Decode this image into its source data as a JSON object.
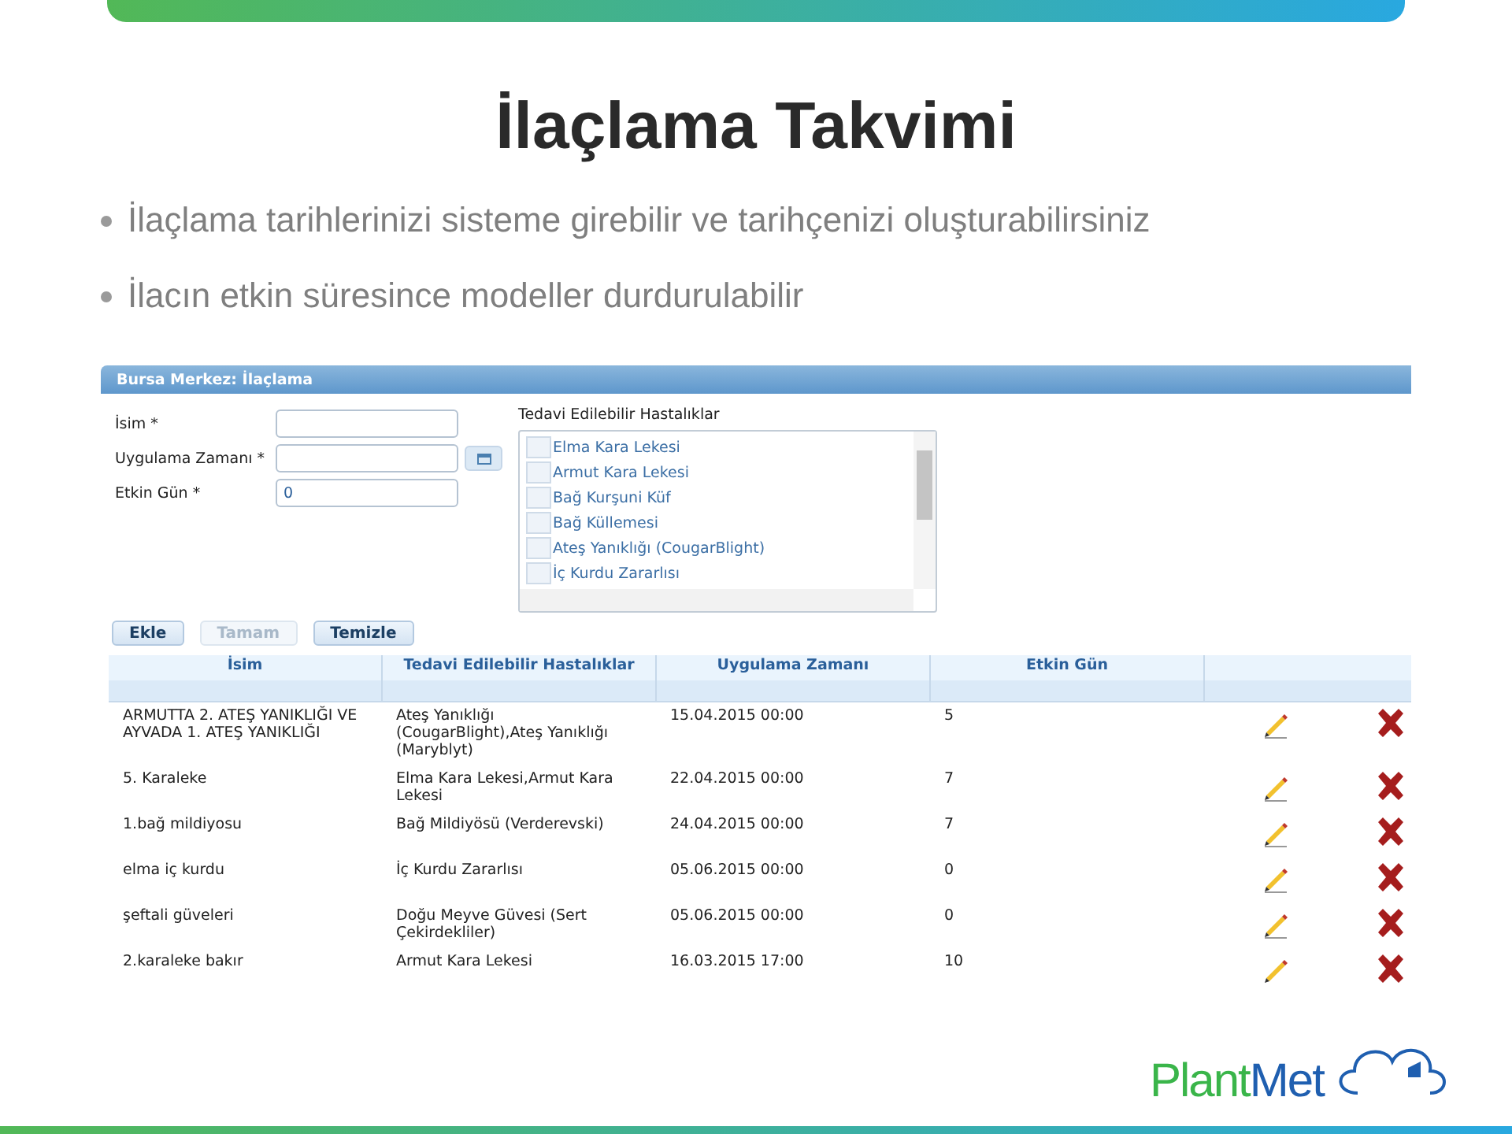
{
  "title": "İlaçlama Takvimi",
  "bullets": [
    "İlaçlama tarihlerinizi sisteme girebilir ve tarihçenizi oluşturabilirsiniz",
    "İlacın etkin süresince modeller durdurulabilir"
  ],
  "panel": {
    "title": "Bursa Merkez: İlaçlama",
    "fields": [
      {
        "label": "İsim *",
        "has_calendar": false
      },
      {
        "label": "Uygulama Zamanı *",
        "has_calendar": true
      },
      {
        "label": "Etkin Gün *",
        "value": "0",
        "has_calendar": false
      }
    ],
    "diseases": {
      "label": "Tedavi Edilebilir Hastalıklar",
      "items": [
        {
          "name": "Elma Kara Lekesi",
          "checked": false
        },
        {
          "name": "Armut Kara Lekesi",
          "checked": false
        },
        {
          "name": "Bağ Kurşuni Küf",
          "checked": false
        },
        {
          "name": "Bağ Küllemesi",
          "checked": false
        },
        {
          "name": "Ateş Yanıklığı (CougarBlight)",
          "checked": false
        },
        {
          "name": "İç Kurdu Zararlısı",
          "checked": false
        }
      ]
    },
    "buttons": [
      {
        "label": "Ekle",
        "disabled": false
      },
      {
        "label": "Tamam",
        "disabled": true
      },
      {
        "label": "Temizle",
        "disabled": false
      }
    ],
    "table": {
      "columns": [
        "İsim",
        "Tedavi Edilebilir Hastalıklar",
        "Uygulama Zamanı",
        "Etkin Gün"
      ],
      "rows": [
        [
          "ARMUTTA 2. ATEŞ YANIKLIĞI VE AYVADA 1. ATEŞ YANIKLIĞI",
          "Ateş Yanıklığı (CougarBlight),Ateş Yanıklığı (Maryblyt)",
          "15.04.2015 00:00",
          "5"
        ],
        [
          "5. Karaleke",
          "Elma Kara Lekesi,Armut Kara Lekesi",
          "22.04.2015 00:00",
          "7"
        ],
        [
          "1.bağ mildiyosu",
          "Bağ Mildiyösü (Verderevski)",
          "24.04.2015 00:00",
          "7"
        ],
        [
          "elma iç kurdu",
          "İç Kurdu Zararlısı",
          "05.06.2015 00:00",
          "0"
        ],
        [
          "şeftali güveleri",
          "Doğu Meyve Güvesi (Sert Çekirdekliler)",
          "05.06.2015 00:00",
          "0"
        ],
        [
          "2.karaleke bakır",
          "Armut Kara Lekesi",
          "16.03.2015 17:00",
          "10"
        ]
      ]
    }
  },
  "logo": {
    "part_1": "Plant",
    "part_2": "Met"
  }
}
